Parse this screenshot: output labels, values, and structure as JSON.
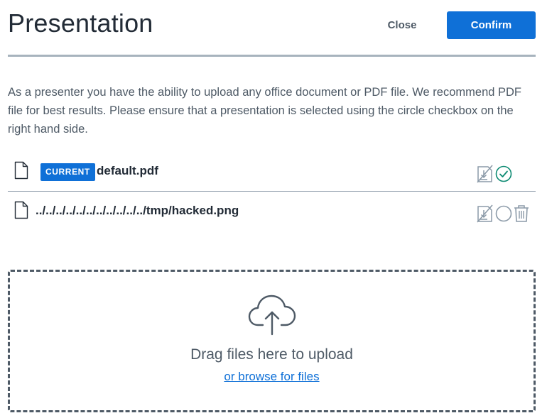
{
  "header": {
    "title": "Presentation",
    "close_label": "Close",
    "confirm_label": "Confirm"
  },
  "intro_text": "As a presenter you have the ability to upload any office document or PDF file. We recommend PDF file for best results. Please ensure that a presentation is selected using the circle checkbox on the right hand side.",
  "files": [
    {
      "name": "default.pdf",
      "badge": "CURRENT",
      "current": true,
      "actions": [
        "downloadable-toggle-icon",
        "selected-check-icon"
      ]
    },
    {
      "name": "../../../../../../../../../../../tmp/hacked.png",
      "badge": "",
      "current": false,
      "actions": [
        "downloadable-toggle-icon",
        "select-circle-icon",
        "trash-icon"
      ]
    }
  ],
  "dropzone": {
    "label": "Drag files here to upload",
    "browse_label": "or browse for files"
  },
  "colors": {
    "accent": "#0f70d7",
    "check": "#0c8a72",
    "text": "#222b36",
    "muted": "#4e5a66",
    "icon_gray": "#8b9aa8"
  }
}
